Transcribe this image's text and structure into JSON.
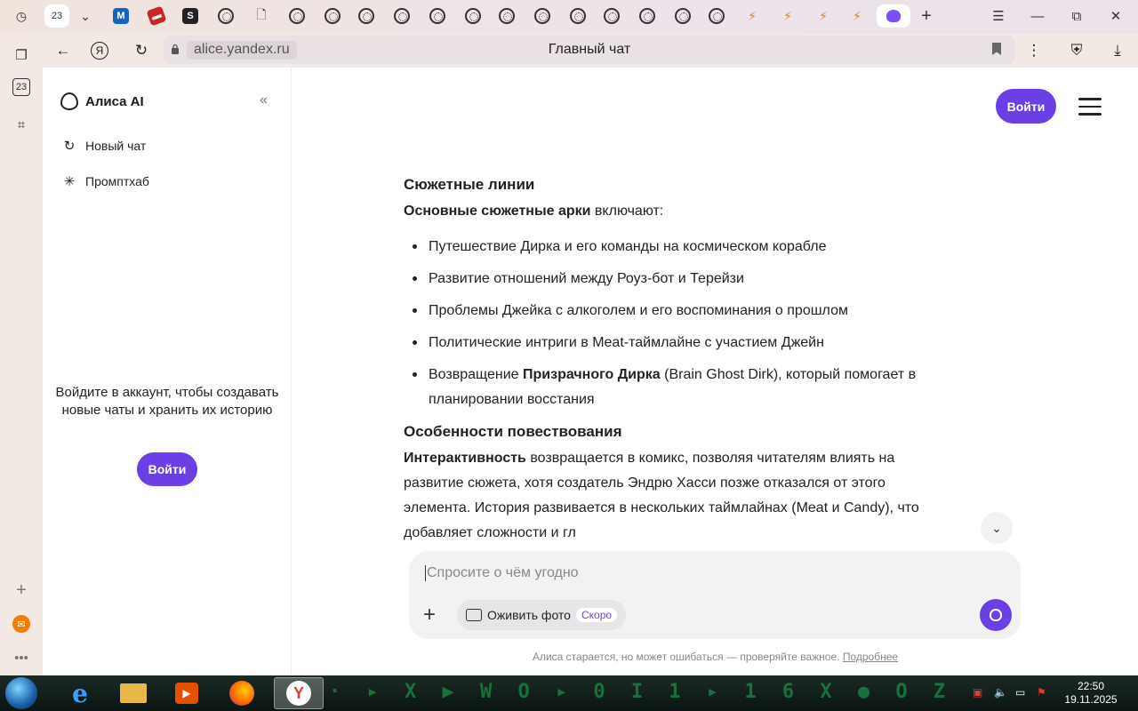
{
  "browser": {
    "tab_counter": "23",
    "url": "alice.yandex.ru",
    "page_title": "Главный чат",
    "sidebar_counter": "23"
  },
  "sidebar": {
    "brand": "Алиса AI",
    "items": [
      {
        "label": "Новый чат",
        "icon": "new-chat-icon"
      },
      {
        "label": "Промптхаб",
        "icon": "sparkle-icon"
      }
    ],
    "login_prompt": "Войдите в аккаунт, чтобы создавать новые чаты и хранить их историю",
    "login_button": "Войти"
  },
  "header": {
    "login_button": "Войти"
  },
  "article": {
    "section1_title": "Сюжетные линии",
    "intro_bold": "Основные сюжетные арки",
    "intro_rest": " включают:",
    "bullets": [
      "Путешествие Дирка и его команды на космическом корабле",
      "Развитие отношений между Роуз-бот и Терейзи",
      "Проблемы Джейка с алкоголем и его воспоминания о прошлом",
      "Политические интриги в Meat-таймлайне с участием Джейн"
    ],
    "bullet5_pre": "Возвращение ",
    "bullet5_bold": "Призрачного Дирка",
    "bullet5_post": " (Brain Ghost Dirk), который помогает в планировании восстания",
    "section2_title": "Особенности повествования",
    "para_bold": "Интерактивность",
    "para_rest": " возвращается в комикс, позволяя читателям влиять на развитие сюжета, хотя создатель Эндрю Хасси позже отказался от этого элемента. История развивается в нескольких таймлайнах (Meat и Candy), что добавляет сложности и гл"
  },
  "composer": {
    "placeholder": "Спросите о чём угодно",
    "chip_label": "Оживить фото",
    "chip_badge": "Скоро"
  },
  "footer": {
    "disclaimer": "Алиса старается, но может ошибаться — проверяйте важное.",
    "more_link": "Подробнее"
  },
  "taskbar": {
    "time": "22:50",
    "date": "19.11.2025"
  },
  "colors": {
    "accent": "#6c3fe6"
  }
}
